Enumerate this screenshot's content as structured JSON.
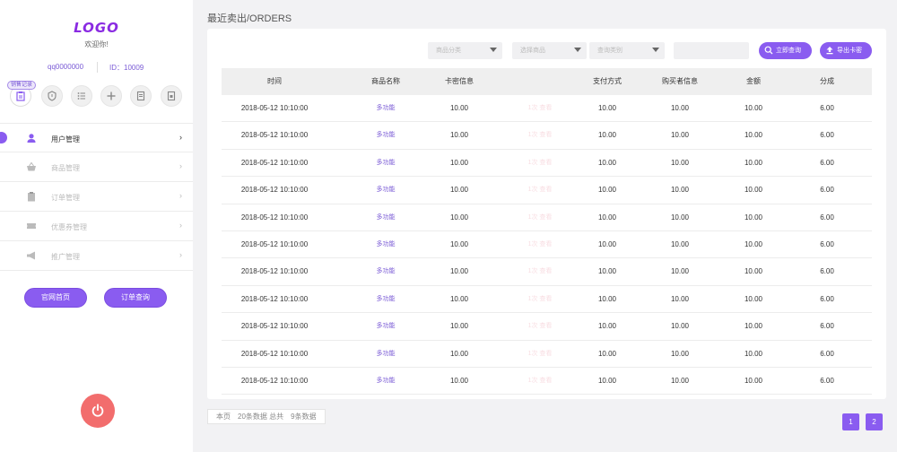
{
  "sidebar": {
    "logo": "LOGO",
    "welcome": "欢迎你!",
    "account": "qq0000000",
    "uid": "ID：10009",
    "quick_badge": "销售记录",
    "menu": [
      {
        "label": "用户管理",
        "icon": "user-icon"
      },
      {
        "label": "商品管理",
        "icon": "basket-icon"
      },
      {
        "label": "订单管理",
        "icon": "clipboard-icon"
      },
      {
        "label": "优惠券管理",
        "icon": "ticket-icon"
      },
      {
        "label": "推广管理",
        "icon": "megaphone-icon"
      }
    ],
    "chevron": "›",
    "home_button": "官网首页",
    "order_query_button": "订单查询"
  },
  "main": {
    "title": "最近卖出/ORDERS",
    "filters": {
      "category": "商品分类",
      "goods": "选择商品",
      "pay_type": "查询类别"
    },
    "query_button": "立即查询",
    "export_button": "导出卡密"
  },
  "table": {
    "headers": [
      "时间",
      "商品名称",
      "卡密信息",
      "支付方式",
      "购买者信息",
      "金额",
      "分成"
    ],
    "rows": [
      {
        "time": "2018-05-12   10:10:00",
        "goods": "多功能",
        "card": "10.00",
        "faint": "1次  查看",
        "pay": "10.00",
        "buyer": "10.00",
        "amount": "10.00",
        "share": "6.00"
      },
      {
        "time": "2018-05-12   10:10:00",
        "goods": "多功能",
        "card": "10.00",
        "faint": "1次  查看",
        "pay": "10.00",
        "buyer": "10.00",
        "amount": "10.00",
        "share": "6.00"
      },
      {
        "time": "2018-05-12   10:10:00",
        "goods": "多功能",
        "card": "10.00",
        "faint": "1次  查看",
        "pay": "10.00",
        "buyer": "10.00",
        "amount": "10.00",
        "share": "6.00"
      },
      {
        "time": "2018-05-12   10:10:00",
        "goods": "多功能",
        "card": "10.00",
        "faint": "1次  查看",
        "pay": "10.00",
        "buyer": "10.00",
        "amount": "10.00",
        "share": "6.00"
      },
      {
        "time": "2018-05-12   10:10:00",
        "goods": "多功能",
        "card": "10.00",
        "faint": "1次  查看",
        "pay": "10.00",
        "buyer": "10.00",
        "amount": "10.00",
        "share": "6.00"
      },
      {
        "time": "2018-05-12   10:10:00",
        "goods": "多功能",
        "card": "10.00",
        "faint": "1次  查看",
        "pay": "10.00",
        "buyer": "10.00",
        "amount": "10.00",
        "share": "6.00"
      },
      {
        "time": "2018-05-12   10:10:00",
        "goods": "多功能",
        "card": "10.00",
        "faint": "1次  查看",
        "pay": "10.00",
        "buyer": "10.00",
        "amount": "10.00",
        "share": "6.00"
      },
      {
        "time": "2018-05-12   10:10:00",
        "goods": "多功能",
        "card": "10.00",
        "faint": "1次  查看",
        "pay": "10.00",
        "buyer": "10.00",
        "amount": "10.00",
        "share": "6.00"
      },
      {
        "time": "2018-05-12   10:10:00",
        "goods": "多功能",
        "card": "10.00",
        "faint": "1次  查看",
        "pay": "10.00",
        "buyer": "10.00",
        "amount": "10.00",
        "share": "6.00"
      },
      {
        "time": "2018-05-12   10:10:00",
        "goods": "多功能",
        "card": "10.00",
        "faint": "1次  查看",
        "pay": "10.00",
        "buyer": "10.00",
        "amount": "10.00",
        "share": "6.00"
      },
      {
        "time": "2018-05-12   10:10:00",
        "goods": "多功能",
        "card": "10.00",
        "faint": "1次  查看",
        "pay": "10.00",
        "buyer": "10.00",
        "amount": "10.00",
        "share": "6.00"
      }
    ]
  },
  "pagination": {
    "info": "本页　20条数据  总共　9条数据",
    "pages": [
      "1",
      "2"
    ]
  },
  "colors": {
    "accent": "#8a5cf0",
    "power": "#f26d6d",
    "logo": "#8a2be2"
  }
}
